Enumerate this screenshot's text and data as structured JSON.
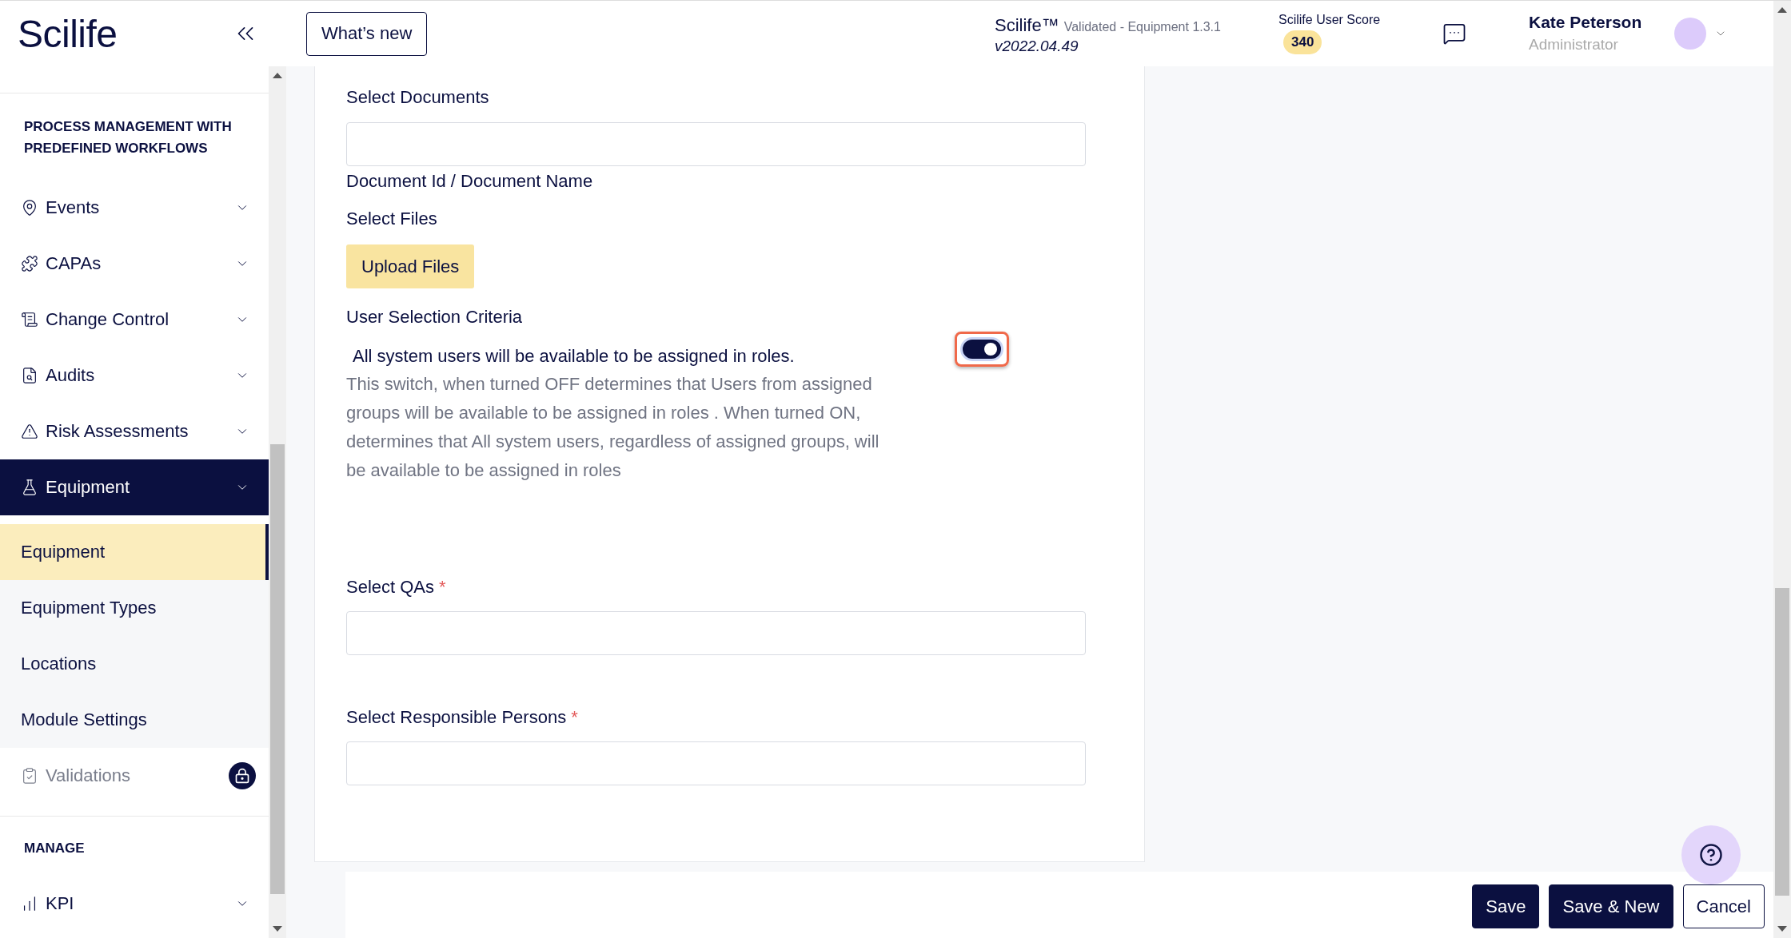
{
  "header": {
    "logo": "Scilife",
    "whats_new": "What’s new",
    "app_info": {
      "name": "Scilife™",
      "edition": "Validated - Equipment 1.3.1",
      "version": "v2022.04.49"
    },
    "score": {
      "label": "Scilife User Score",
      "value": "340"
    },
    "user": {
      "name": "Kate Peterson",
      "role": "Administrator"
    }
  },
  "sidebar": {
    "section_title": "PROCESS MANAGEMENT WITH PREDEFINED WORKFLOWS",
    "items": [
      {
        "label": "Events",
        "kind": "menu",
        "selected": false
      },
      {
        "label": "CAPAs",
        "kind": "menu",
        "selected": false
      },
      {
        "label": "Change Control",
        "kind": "menu",
        "selected": false
      },
      {
        "label": "Audits",
        "kind": "menu",
        "selected": false
      },
      {
        "label": "Risk Assessments",
        "kind": "menu",
        "selected": false
      },
      {
        "label": "Equipment",
        "kind": "menu",
        "selected": true,
        "children": [
          {
            "label": "Equipment",
            "selected": true
          },
          {
            "label": "Equipment Types",
            "selected": false
          },
          {
            "label": "Locations",
            "selected": false
          },
          {
            "label": "Module Settings",
            "selected": false
          }
        ]
      },
      {
        "label": "Validations",
        "kind": "locked",
        "selected": false
      }
    ],
    "manage_title": "MANAGE",
    "manage_items": [
      {
        "label": "KPI",
        "kind": "menu",
        "selected": false
      }
    ]
  },
  "form": {
    "documents": {
      "label": "Select Documents",
      "note": "Document Id / Document Name"
    },
    "files": {
      "label": "Select Files",
      "button": "Upload Files"
    },
    "user_selection": {
      "label": "User Selection Criteria",
      "status": "All system users will be available to be assigned in roles.",
      "on": true,
      "highlighted": true,
      "description": "This switch, when turned OFF determines that Users from assigned groups will be available to be assigned in roles . When turned ON, determines that All system users, regardless of assigned groups, will be available to be assigned in roles"
    },
    "fields": [
      {
        "label": "Select QAs",
        "required_mark": "*"
      },
      {
        "label": "Select Responsible Persons",
        "required_mark": "*"
      }
    ]
  },
  "footer": {
    "buttons": [
      {
        "label": "Save",
        "kind": "primary"
      },
      {
        "label": "Save & New",
        "kind": "primary"
      },
      {
        "label": "Cancel",
        "kind": "secondary"
      }
    ]
  }
}
